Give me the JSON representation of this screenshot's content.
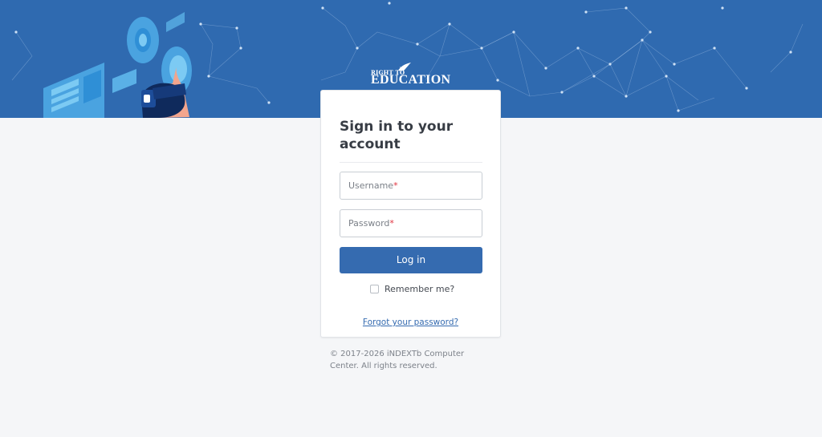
{
  "brand": {
    "logo_top": "RIGHT TO",
    "logo_main": "EDUCATION"
  },
  "login": {
    "title": "Sign in to your account",
    "username_placeholder": "Username",
    "password_placeholder": "Password",
    "required_mark": "*",
    "submit_label": "Log in",
    "remember_label": "Remember me?",
    "remember_checked": false,
    "forgot_label": "Forgot your password?"
  },
  "footer": {
    "copyright": "© 2017-2026 iNDEXTb Computer Center. All rights reserved."
  },
  "colors": {
    "banner": "#2f6ab0",
    "primary": "#356bb0",
    "background": "#f5f6f8",
    "required": "#e0333f"
  },
  "icons": {
    "logo_mark": "bird-book-icon",
    "checkbox": "checkbox-icon"
  }
}
